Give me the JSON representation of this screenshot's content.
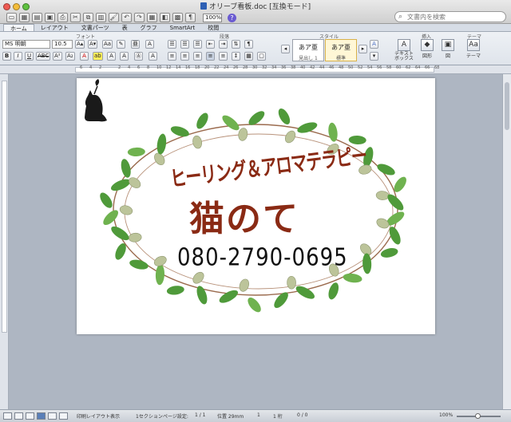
{
  "window": {
    "title": "オリーブ看板.doc [互換モード]",
    "zoom": "100%",
    "search_placeholder": "文書内を検索"
  },
  "tabs": [
    {
      "label": "ホーム",
      "active": true
    },
    {
      "label": "レイアウト",
      "active": false
    },
    {
      "label": "文書パーツ",
      "active": false
    },
    {
      "label": "表",
      "active": false
    },
    {
      "label": "グラフ",
      "active": false
    },
    {
      "label": "SmartArt",
      "active": false
    },
    {
      "label": "校閲",
      "active": false
    }
  ],
  "ribbon": {
    "font_group": "フォント",
    "paragraph_group": "段落",
    "style_group": "スタイル",
    "insert_group": "挿入",
    "theme_group": "テーマ",
    "font_name": "MS 明朝",
    "font_size": "10.5",
    "styles": [
      {
        "sample": "あア亜",
        "name": "見出し 1"
      },
      {
        "sample": "あア亜",
        "name": "標準"
      }
    ],
    "insert_textbox": "テキスト\nボックス",
    "insert_shape": "図形",
    "insert_picture": "図",
    "theme": "テーマ"
  },
  "document": {
    "heading": "ヒーリング＆アロマテラピー",
    "shop_name": "猫のて",
    "phone": "080-2790-0695"
  },
  "status": {
    "view": "印刷レイアウト表示",
    "section": "1セクション",
    "page_label": "ページ設定:",
    "page_value": "1 / 1",
    "position": "位置 29mm",
    "line": "1",
    "column": "1 桁",
    "words": "0 / 0",
    "zoom": "100%"
  },
  "colors": {
    "text_brown": "#8a2a14",
    "leaf_green": "#4f9a3a",
    "olive": "#bcc49a"
  }
}
